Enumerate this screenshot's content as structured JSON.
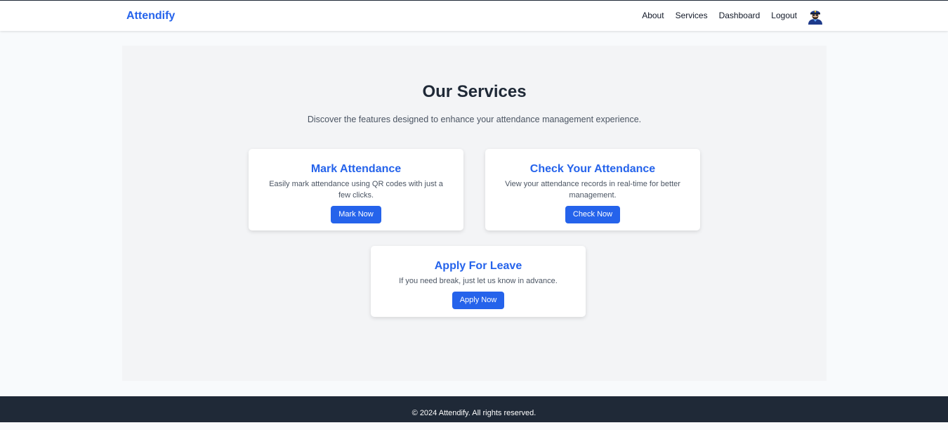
{
  "header": {
    "brand": "Attendify",
    "nav": {
      "about": "About",
      "services": "Services",
      "dashboard": "Dashboard",
      "logout": "Logout"
    },
    "avatar_icon": "police-officer-icon"
  },
  "main": {
    "title": "Our Services",
    "subtitle": "Discover the features designed to enhance your attendance management experience.",
    "cards": [
      {
        "title": "Mark Attendance",
        "description": "Easily mark attendance using QR codes with just a few clicks.",
        "button": "Mark Now"
      },
      {
        "title": "Check Your Attendance",
        "description": "View your attendance records in real-time for better management.",
        "button": "Check Now"
      },
      {
        "title": "Apply For Leave",
        "description": "If you need break, just let us know in advance.",
        "button": "Apply Now"
      }
    ]
  },
  "footer": {
    "text": "© 2024 Attendify. All rights reserved."
  },
  "colors": {
    "accent": "#2563eb",
    "footer_bg": "#1f2937",
    "panel_bg": "#f3f4f6"
  }
}
